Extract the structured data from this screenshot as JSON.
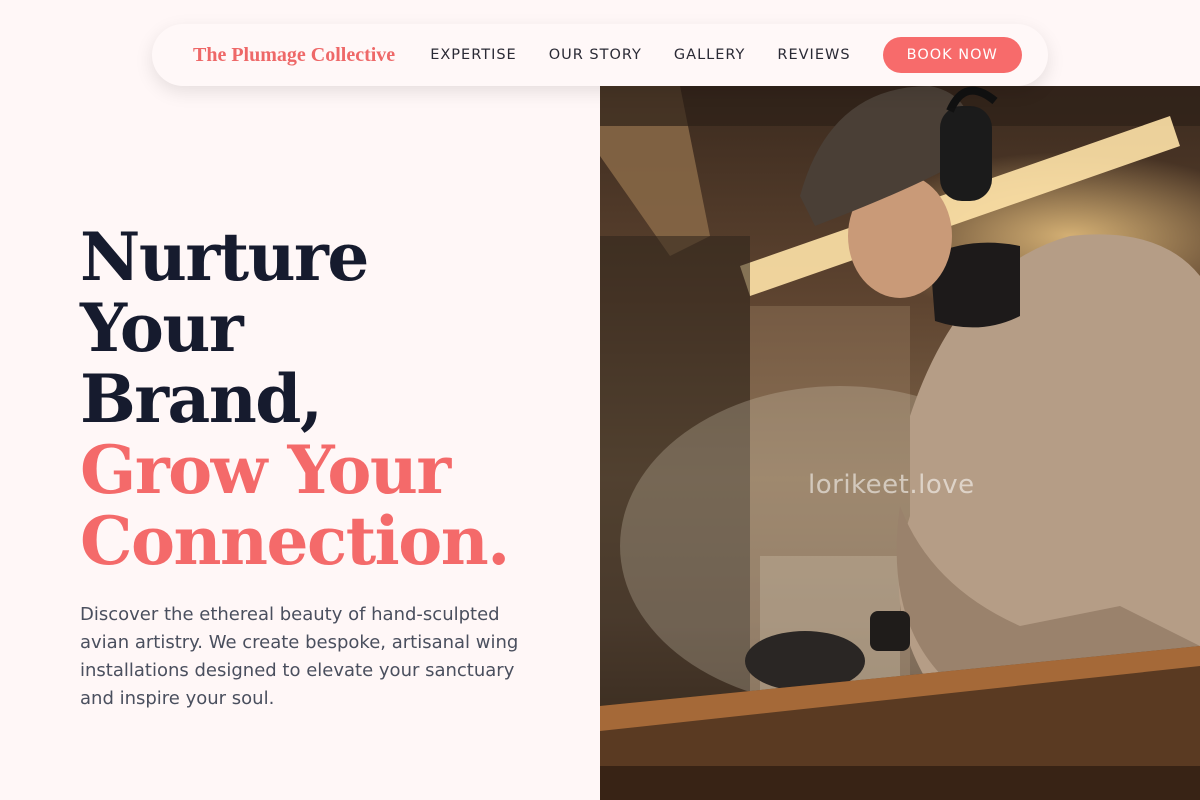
{
  "nav": {
    "brand": "The Plumage Collective",
    "links": [
      "EXPERTISE",
      "OUR STORY",
      "GALLERY",
      "REVIEWS"
    ],
    "cta": "BOOK NOW"
  },
  "hero": {
    "headline_dark_1": "Nurture Your",
    "headline_dark_2": "Brand,",
    "headline_accent_1": "Grow Your",
    "headline_accent_2": "Connection.",
    "description": "Discover the ethereal beauty of hand-sculpted avian artistry. We create bespoke, artisanal wing installations designed to elevate your sanctuary and inspire your soul.",
    "image": {
      "subject": "craftsman wearing flat cap and ear protection working at a bench in a smoky workshop",
      "watermark": "lorikeet.love"
    }
  },
  "colors": {
    "background": "#fff7f7",
    "accent": "#f46a6a",
    "heading": "#161b2e",
    "button": "#f76b6b"
  }
}
